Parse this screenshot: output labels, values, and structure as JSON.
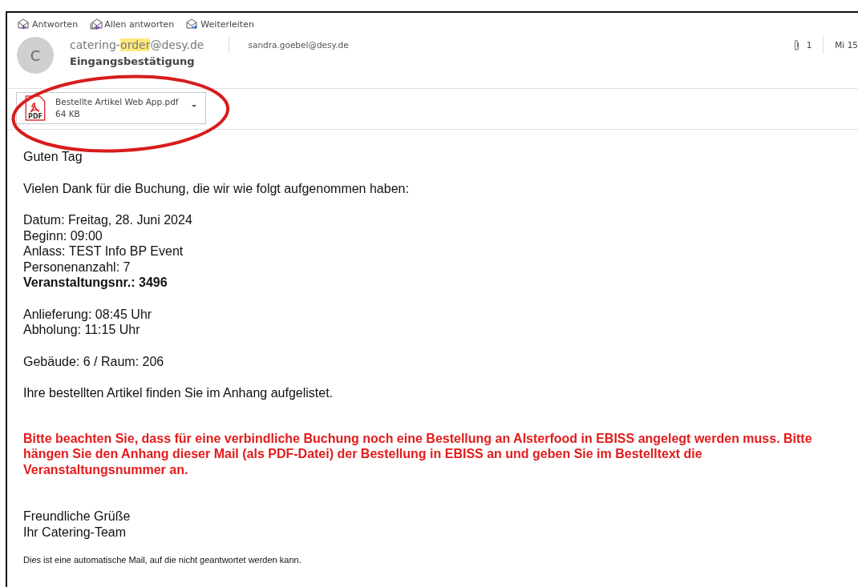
{
  "toolbar": [
    {
      "label": "Antworten",
      "kind": "reply"
    },
    {
      "label": "Allen antworten",
      "kind": "reply-all"
    },
    {
      "label": "Weiterleiten",
      "kind": "forward"
    }
  ],
  "message": {
    "avatar_initial": "C",
    "sender": [
      {
        "text": "catering-",
        "highlighted": false
      },
      {
        "text": "order",
        "highlighted": true
      },
      {
        "text": "@desy.de",
        "highlighted": false
      }
    ],
    "recipient": "sandra.goebel@desy.de",
    "attachment_count": "1",
    "date": "Mi 15",
    "subject": "Eingangsbestätigung"
  },
  "attachment": {
    "name": "Bestellte Artikel Web App.pdf",
    "size": "64 KB",
    "type_label": "PDF"
  },
  "annotation": {
    "kind": "ellipse"
  },
  "body": [
    {
      "kind": "normal",
      "lines": [
        {
          "text": "Guten Tag",
          "kind": "plain"
        }
      ]
    },
    {
      "kind": "normal",
      "lines": [
        {
          "text": "Vielen Dank für die Buchung, die wir wie folgt aufgenommen haben:",
          "kind": "plain"
        }
      ]
    },
    {
      "kind": "normal",
      "lines": [
        {
          "text": "Datum: Freitag, 28. Juni 2024",
          "kind": "plain"
        },
        {
          "text": "Beginn: 09:00",
          "kind": "plain"
        },
        {
          "text": "Anlass: TEST Info BP Event",
          "kind": "plain"
        },
        {
          "text": "Personenanzahl: 7",
          "kind": "plain"
        },
        {
          "text": "Veranstaltungsnr.: 3496",
          "kind": "strong"
        }
      ]
    },
    {
      "kind": "normal",
      "lines": [
        {
          "text": "Anlieferung: 08:45 Uhr",
          "kind": "plain"
        },
        {
          "text": "Abholung: 11:15 Uhr",
          "kind": "plain"
        }
      ]
    },
    {
      "kind": "normal",
      "lines": [
        {
          "text": "Gebäude: 6 / Raum: 206",
          "kind": "plain"
        }
      ]
    },
    {
      "kind": "normal",
      "lines": [
        {
          "text": "Ihre bestellten Artikel finden Sie im Anhang aufgelistet.",
          "kind": "plain"
        }
      ]
    },
    {
      "kind": "warning",
      "lines": [
        {
          "text": "Bitte beachten Sie, dass für eine verbindliche Buchung noch eine Bestellung an Alsterfood in EBISS angelegt werden muss. Bitte hängen Sie den Anhang dieser Mail (als PDF-Datei) der Bestellung in EBISS an und geben Sie im Bestelltext die Veranstaltungsnummer an.",
          "kind": "plain"
        }
      ]
    },
    {
      "kind": "normal",
      "lines": [
        {
          "text": "Freundliche Grüße",
          "kind": "plain"
        },
        {
          "text": "Ihr Catering-Team",
          "kind": "plain"
        }
      ]
    },
    {
      "kind": "note",
      "lines": [
        {
          "text": "Dies ist eine automatische Mail, auf die nicht geantwortet werden kann.",
          "kind": "plain"
        }
      ]
    }
  ]
}
